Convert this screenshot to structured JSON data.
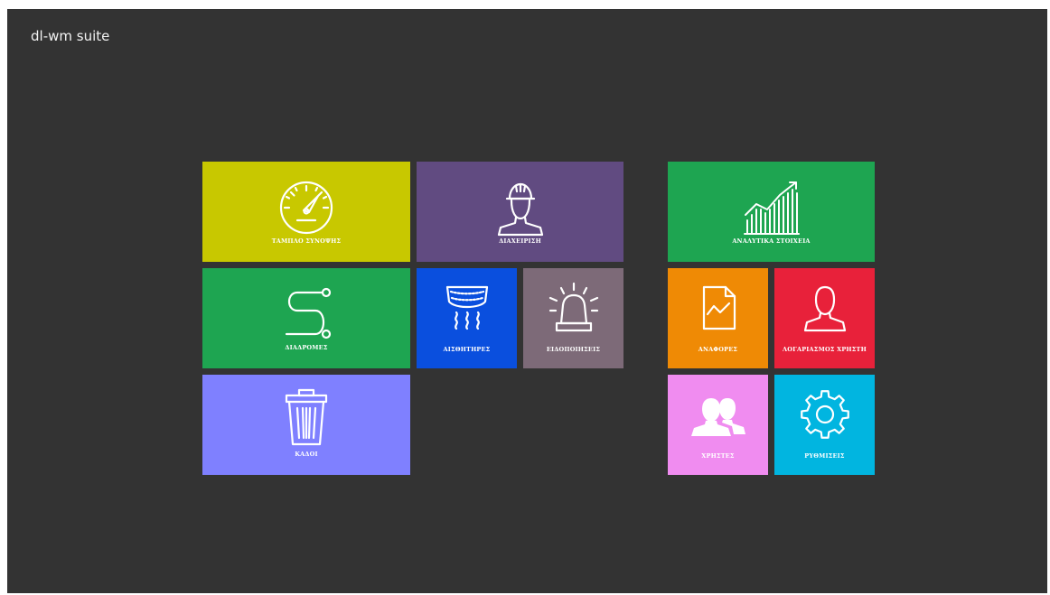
{
  "app": {
    "title": "dl-wm suite"
  },
  "tiles": [
    {
      "id": "dashboard",
      "label": "ΤΑΜΠΛΟ ΣΥΝΟΨΗΣ",
      "icon": "speedometer-icon",
      "color": "#c8c800"
    },
    {
      "id": "management",
      "label": "ΔΙΑΧΕΙΡΙΣΗ",
      "icon": "worker-icon",
      "color": "#614b81"
    },
    {
      "id": "analytics",
      "label": "ΑΝΑΛΥΤΙΚΑ ΣΤΟΙΧΕΙΑ",
      "icon": "growth-chart-icon",
      "color": "#1ea551"
    },
    {
      "id": "routes",
      "label": "ΔΙΑΔΡΟΜΕΣ",
      "icon": "route-icon",
      "color": "#1ea551"
    },
    {
      "id": "sensors",
      "label": "ΑΙΣΘΗΤΗΡΕΣ",
      "icon": "sensor-icon",
      "color": "#0a4fde"
    },
    {
      "id": "notifications",
      "label": "ΕΙΔΟΠΟΙΗΣΕΙΣ",
      "icon": "siren-icon",
      "color": "#7d6a78"
    },
    {
      "id": "reports",
      "label": "ΑΝΑΦΟΡΕΣ",
      "icon": "report-document-icon",
      "color": "#ef8a05"
    },
    {
      "id": "user-account",
      "label": "ΛΟΓΑΡΙΑΣΜΟΣ ΧΡΗΣΤΗ",
      "icon": "user-icon",
      "color": "#e8213a"
    },
    {
      "id": "bins",
      "label": "ΚΑΔΟΙ",
      "icon": "trash-bin-icon",
      "color": "#7f80ff"
    },
    {
      "id": "users",
      "label": "ΧΡΗΣΤΕΣ",
      "icon": "users-icon",
      "color": "#f08cf0"
    },
    {
      "id": "settings",
      "label": "ΡΥΘΜΙΣΕΙΣ",
      "icon": "gear-icon",
      "color": "#01b5e0"
    }
  ]
}
